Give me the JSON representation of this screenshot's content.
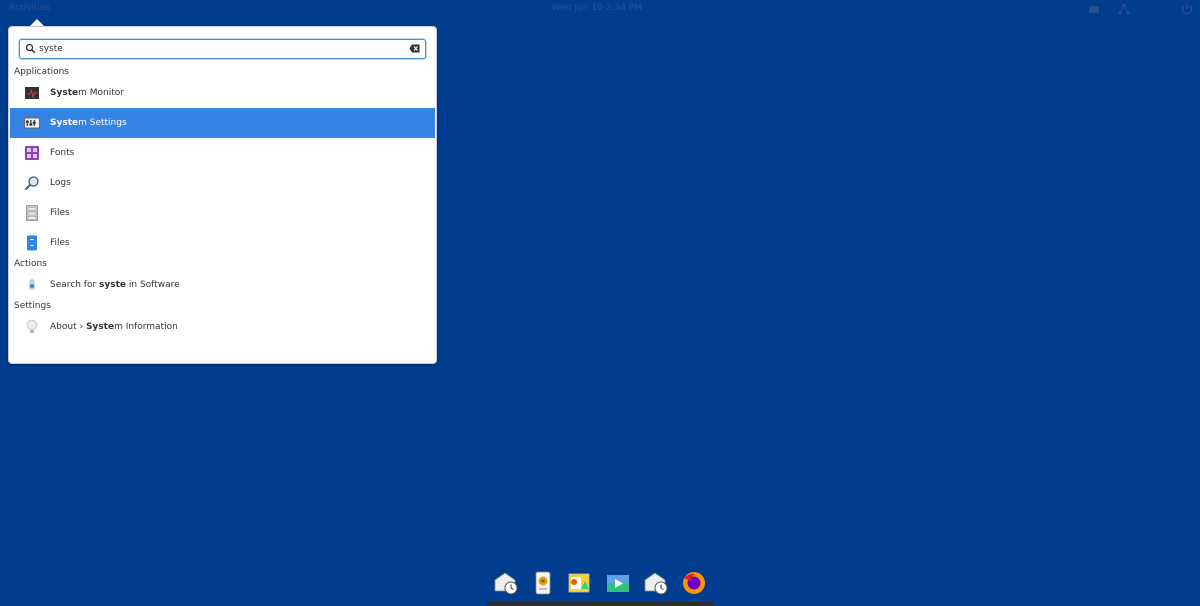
{
  "topbar": {
    "activities": "Activities",
    "clock": "Wed Jun 10 2:34 PM"
  },
  "search": {
    "value": "syste"
  },
  "sections": {
    "applications": "Applications",
    "actions": "Actions",
    "settings": "Settings"
  },
  "apps": [
    {
      "bold": "Syste",
      "rest": "m Monitor",
      "icon": "system-monitor-icon"
    },
    {
      "bold": "Syste",
      "rest": "m Settings",
      "icon": "system-settings-icon"
    },
    {
      "plain": "Fonts",
      "icon": "fonts-icon"
    },
    {
      "plain": "Logs",
      "icon": "logs-icon"
    },
    {
      "plain": "Files",
      "icon": "file-cabinet-icon"
    },
    {
      "plain": "Files",
      "icon": "files-icon"
    }
  ],
  "actions": {
    "prefix": "Search for ",
    "query": "syste",
    "suffix": " in Software"
  },
  "settings_item": {
    "prefix": "About › ",
    "bold": "Syste",
    "rest": "m Information"
  },
  "colors": {
    "desktop": "#003d8f",
    "selection": "#3584e4",
    "focus": "#4a90d9"
  }
}
